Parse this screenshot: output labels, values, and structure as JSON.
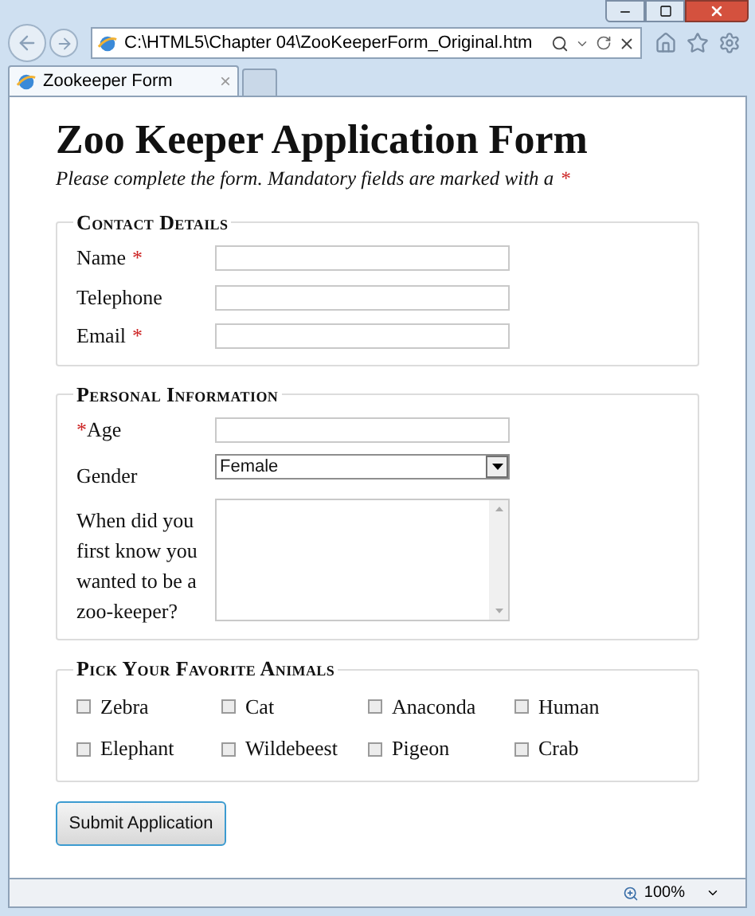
{
  "window": {
    "address": "C:\\HTML5\\Chapter 04\\ZooKeeperForm_Original.htm"
  },
  "tabs": [
    {
      "label": "Zookeeper Form",
      "close": "×",
      "selected": true
    }
  ],
  "page": {
    "title": "Zoo Keeper Application Form",
    "subtitle": "Please complete the form. Mandatory fields are marked with a",
    "subtitle_mark": "*"
  },
  "sections": [
    {
      "legend": "Contact Details",
      "fields": [
        {
          "kind": "text",
          "label": "Name",
          "mark": "*",
          "mark_first": false
        },
        {
          "kind": "text",
          "label": "Telephone"
        },
        {
          "kind": "text",
          "label": "Email",
          "mark": "*",
          "mark_first": false
        }
      ]
    },
    {
      "legend": "Personal Information",
      "fields": [
        {
          "kind": "text",
          "label": "Age",
          "mark": "*",
          "mark_first": true
        },
        {
          "kind": "select",
          "label": "Gender",
          "value": "Female"
        },
        {
          "kind": "textarea",
          "label": "When did you first know you wanted to be a zoo-keeper?"
        }
      ]
    },
    {
      "legend": "Pick Your Favorite Animals",
      "fields": [
        {
          "kind": "checkbox",
          "label": "Zebra",
          "checked": false
        },
        {
          "kind": "checkbox",
          "label": "Cat",
          "checked": false
        },
        {
          "kind": "checkbox",
          "label": "Anaconda",
          "checked": false
        },
        {
          "kind": "checkbox",
          "label": "Human",
          "checked": false
        },
        {
          "kind": "checkbox",
          "label": "Elephant",
          "checked": false
        },
        {
          "kind": "checkbox",
          "label": "Wildebeest",
          "checked": false
        },
        {
          "kind": "checkbox",
          "label": "Pigeon",
          "checked": false
        },
        {
          "kind": "checkbox",
          "label": "Crab",
          "checked": false
        }
      ]
    }
  ],
  "submit": "Submit Application",
  "status_bar": {
    "zoom": "100%"
  }
}
